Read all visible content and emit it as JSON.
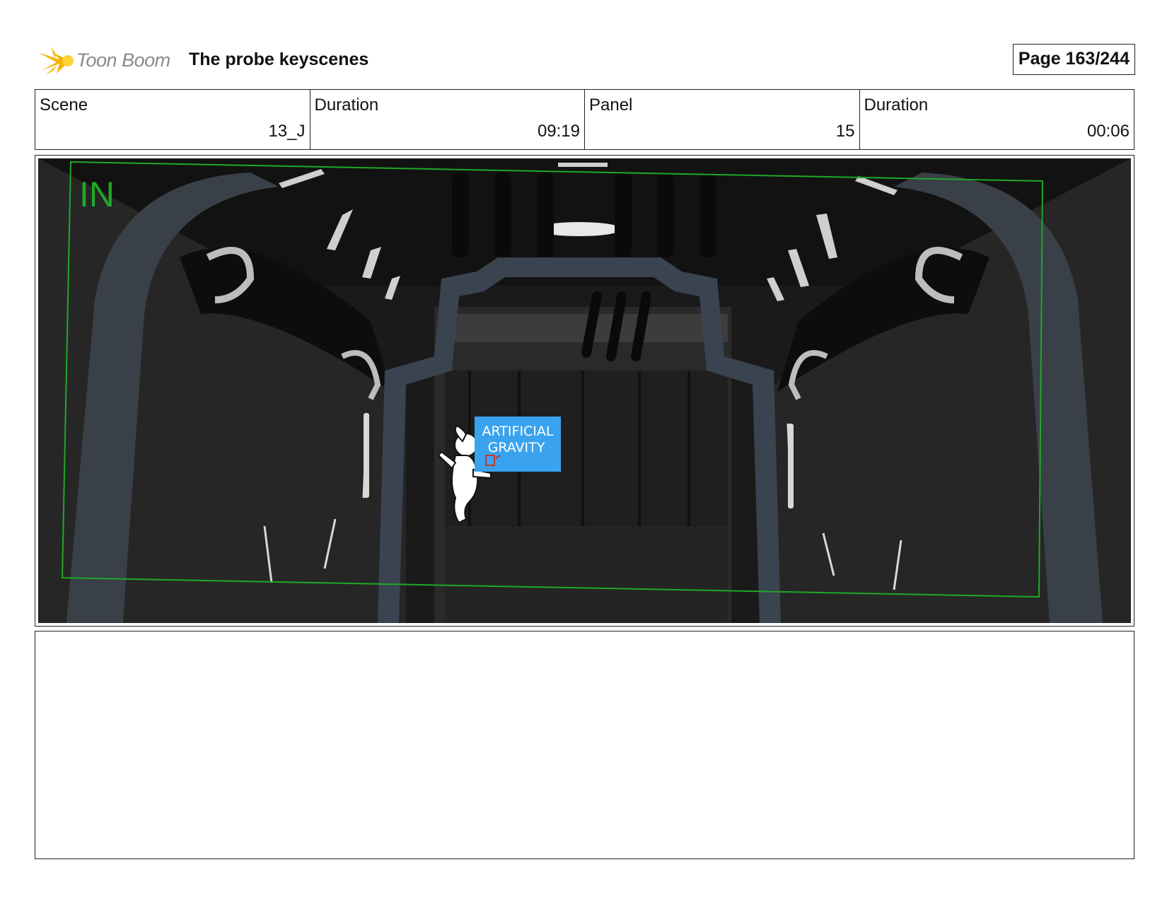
{
  "header": {
    "logo_text": "Toon Boom",
    "project_title": "The probe keyscenes",
    "page_label": "Page 163/244"
  },
  "info": {
    "scene_label": "Scene",
    "scene_value": "13_J",
    "scene_duration_label": "Duration",
    "scene_duration_value": "09:19",
    "panel_label": "Panel",
    "panel_value": "15",
    "panel_duration_label": "Duration",
    "panel_duration_value": "00:06"
  },
  "panel": {
    "safe_area_label": "IN",
    "sign_line_1": "ARTIFICIAL",
    "sign_line_2": "GRAVITY"
  },
  "colors": {
    "safe_area": "#1fa827",
    "sign_bg": "#3aa3ef",
    "logo_star": "#f5b400"
  },
  "notes": {
    "text": ""
  }
}
